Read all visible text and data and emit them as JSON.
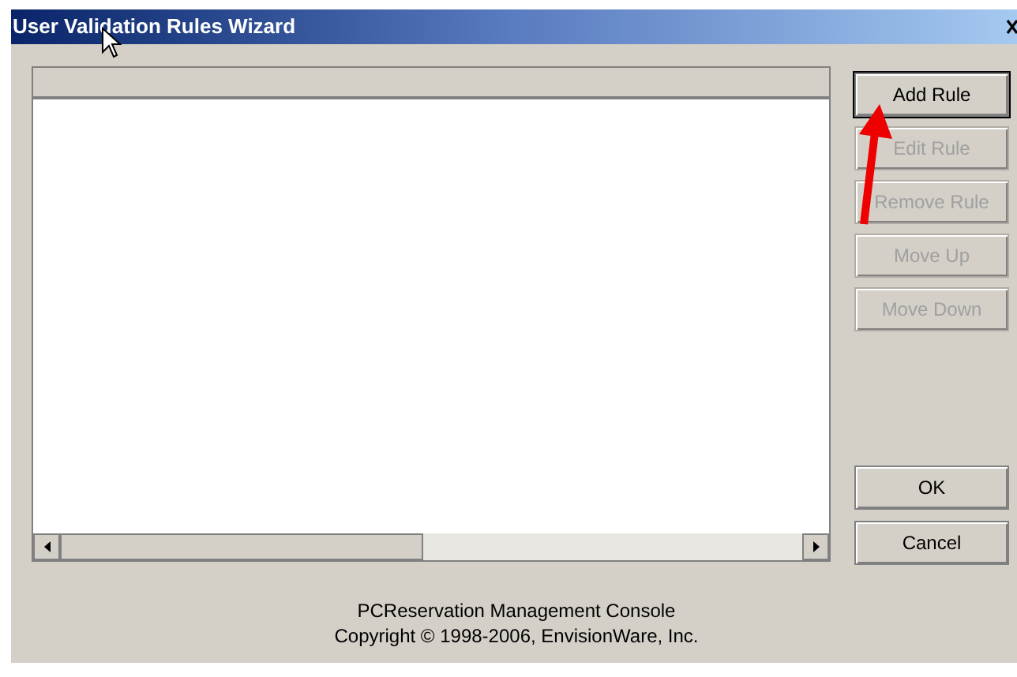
{
  "window": {
    "title": "User Validation Rules Wizard"
  },
  "buttons": [
    {
      "label": "Add Rule",
      "disabled": false,
      "focused": true
    },
    {
      "label": "Edit Rule",
      "disabled": true,
      "focused": false
    },
    {
      "label": "Remove Rule",
      "disabled": true,
      "focused": false
    },
    {
      "label": "Move Up",
      "disabled": true,
      "focused": false
    },
    {
      "label": "Move Down",
      "disabled": true,
      "focused": false
    }
  ],
  "dialog_buttons": [
    {
      "label": "OK"
    },
    {
      "label": "Cancel"
    }
  ],
  "footer": [
    "PCReservation Management Console",
    "Copyright © 1998-2006, EnvisionWare, Inc."
  ]
}
